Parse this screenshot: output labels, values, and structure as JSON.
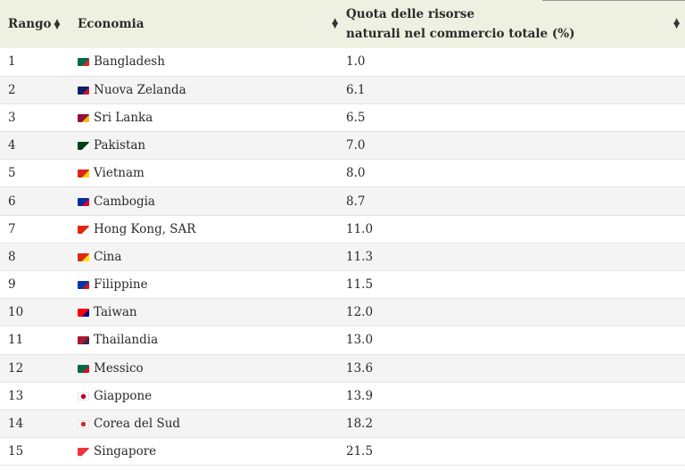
{
  "header": {
    "rank": "Rango",
    "economy": "Economia",
    "quota_line1": "Quota delle risorse",
    "quota_line2": "naturali nel commercio totale (%)"
  },
  "rows": [
    {
      "rank": "1",
      "name": "Bangladesh",
      "value": "1.0",
      "flag_colors": [
        "#006a4e",
        "#d62828"
      ]
    },
    {
      "rank": "2",
      "name": "Nuova Zelanda",
      "value": "6.1",
      "flag_colors": [
        "#012169",
        "#c8102e"
      ]
    },
    {
      "rank": "3",
      "name": "Sri Lanka",
      "value": "6.5",
      "flag_colors": [
        "#8d153a",
        "#f7b718"
      ]
    },
    {
      "rank": "4",
      "name": "Pakistan",
      "value": "7.0",
      "flag_colors": [
        "#01411c",
        "#ffffff"
      ]
    },
    {
      "rank": "5",
      "name": "Vietnam",
      "value": "8.0",
      "flag_colors": [
        "#da251d",
        "#ffcd00"
      ]
    },
    {
      "rank": "6",
      "name": "Cambogia",
      "value": "8.7",
      "flag_colors": [
        "#032ea1",
        "#e00025"
      ]
    },
    {
      "rank": "7",
      "name": "Hong Kong, SAR",
      "value": "11.0",
      "flag_colors": [
        "#de2910",
        "#ffffff"
      ]
    },
    {
      "rank": "8",
      "name": "Cina",
      "value": "11.3",
      "flag_colors": [
        "#de2910",
        "#ffde00"
      ]
    },
    {
      "rank": "9",
      "name": "Filippine",
      "value": "11.5",
      "flag_colors": [
        "#0038a8",
        "#ce1126"
      ]
    },
    {
      "rank": "10",
      "name": "Taiwan",
      "value": "12.0",
      "flag_colors": [
        "#fe0000",
        "#000095"
      ]
    },
    {
      "rank": "11",
      "name": "Thailandia",
      "value": "13.0",
      "flag_colors": [
        "#a51931",
        "#2d2a4a"
      ]
    },
    {
      "rank": "12",
      "name": "Messico",
      "value": "13.6",
      "flag_colors": [
        "#006847",
        "#ce1126"
      ]
    },
    {
      "rank": "13",
      "name": "Giappone",
      "value": "13.9",
      "flag_colors": [
        "#ffffff",
        "#bc002d"
      ]
    },
    {
      "rank": "14",
      "name": "Corea del Sud",
      "value": "18.2",
      "flag_colors": [
        "#ffffff",
        "#cd2e3a"
      ]
    },
    {
      "rank": "15",
      "name": "Singapore",
      "value": "21.5",
      "flag_colors": [
        "#ef3340",
        "#ffffff"
      ]
    }
  ],
  "icons": {
    "sort": "sort-icon",
    "flags": "country-flag-icon"
  }
}
